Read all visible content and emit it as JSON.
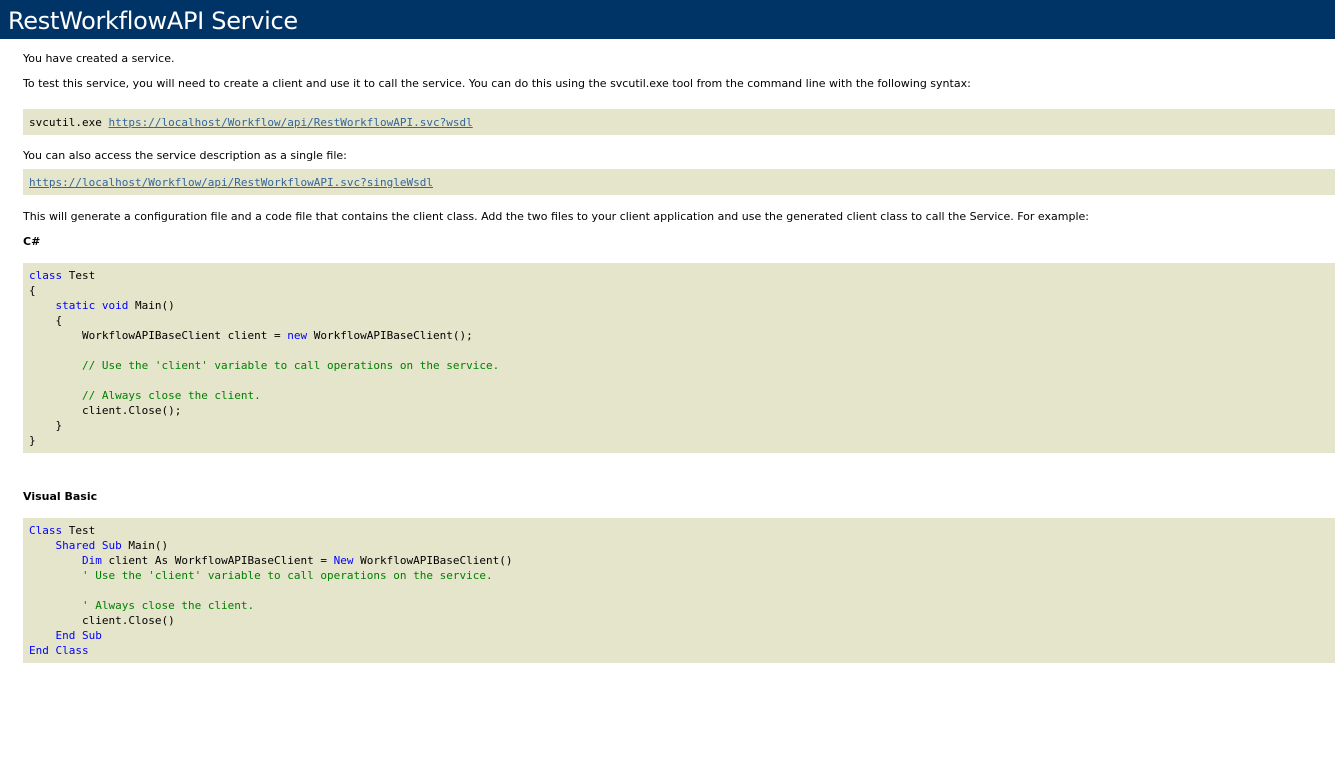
{
  "page": {
    "title": "RestWorkflowAPI Service"
  },
  "intro": {
    "created": "You have created a service.",
    "instructions": "To test this service, you will need to create a client and use it to call the service. You can do this using the svcutil.exe tool from the command line with the following syntax:"
  },
  "svcutil": {
    "command": "svcutil.exe",
    "wsdl_url": "https://localhost/Workflow/api/RestWorkflowAPI.svc?wsdl"
  },
  "single_file": {
    "text": "You can also access the service description as a single file:",
    "url": "https://localhost/Workflow/api/RestWorkflowAPI.svc?singleWsdl"
  },
  "generate_text": "This will generate a configuration file and a code file that contains the client class. Add the two files to your client application and use the generated client class to call the Service. For example:",
  "csharp": {
    "label": "C#",
    "kw_class": "class",
    "class_name": " Test",
    "open_brace": "{",
    "kw_static_void": "static void",
    "main_sig": " Main()",
    "inner_open": "{",
    "client_decl": "WorkflowAPIBaseClient client = ",
    "kw_new": "new",
    "client_ctor": " WorkflowAPIBaseClient();",
    "comment_use": "// Use the 'client' variable to call operations on the service.",
    "comment_close": "// Always close the client.",
    "close_call": "client.Close();",
    "inner_close": "}",
    "close_brace": "}"
  },
  "vb": {
    "label": "Visual Basic",
    "kw_class": "Class",
    "class_name": " Test",
    "kw_shared_sub": "Shared Sub",
    "main_sig": " Main()",
    "kw_dim": "Dim",
    "client_decl": " client As WorkflowAPIBaseClient = ",
    "kw_new": "New",
    "client_ctor": " WorkflowAPIBaseClient()",
    "comment_use": "' Use the 'client' variable to call operations on the service.",
    "comment_close": "' Always close the client.",
    "close_call": "client.Close()",
    "kw_end_sub": "End Sub",
    "kw_end_class": "End Class"
  },
  "colors": {
    "header_bg": "#003366",
    "code_bg": "#e5e5cc",
    "keyword": "#0000ff",
    "comment": "#008000",
    "link": "#336699"
  }
}
